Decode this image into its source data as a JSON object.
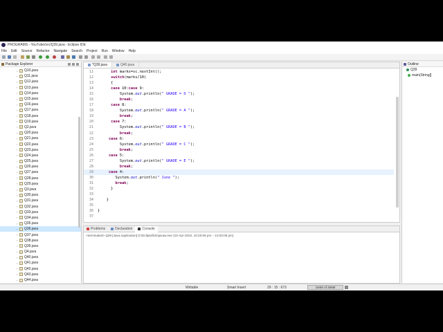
{
  "window": {
    "title": "PROGRAMS - YouTube/src/Q39.java - Eclipse IDE"
  },
  "menu": [
    "File",
    "Edit",
    "Source",
    "Refactor",
    "Navigate",
    "Search",
    "Project",
    "Run",
    "Window",
    "Help"
  ],
  "package_explorer": {
    "title": "Package Explorer",
    "items": [
      "Q10.java",
      "Q11.java",
      "Q12.java",
      "Q13.java",
      "Q14.java",
      "Q15.java",
      "Q16.java",
      "Q17.java",
      "Q18.java",
      "Q19.java",
      "Q2.java",
      "Q20.java",
      "Q21.java",
      "Q22.java",
      "Q23.java",
      "Q24.java",
      "Q25.java",
      "Q26.java",
      "Q27.java",
      "Q28.java",
      "Q29.java",
      "Q3.java",
      "Q30.java",
      "Q31.java",
      "Q32.java",
      "Q33.java",
      "Q34.java",
      "Q35.java",
      "Q36.java",
      "Q37.java",
      "Q38.java",
      "Q39.java",
      "Q4.java",
      "Q40.java",
      "Q41.java",
      "Q42.java",
      "Q43.java",
      "Q44.java"
    ],
    "selected": "Q36.java"
  },
  "editor": {
    "tabs": [
      "*Q39.java",
      "Q40.java"
    ],
    "active_tab": "*Q39.java",
    "current_line": "29",
    "lines": [
      {
        "n": "11",
        "t": "      int marks=sc.nextInt();"
      },
      {
        "n": "12",
        "t": "      switch(marks/10)"
      },
      {
        "n": "13",
        "t": "      {"
      },
      {
        "n": "14",
        "t": "      case 10:case 9:"
      },
      {
        "n": "15",
        "t": "          System.out.println(\" GRADE = O \");"
      },
      {
        "n": "16",
        "t": "          break;"
      },
      {
        "n": "17",
        "t": "      case 8:"
      },
      {
        "n": "18",
        "t": "          System.out.println(\" GRADE = A \");"
      },
      {
        "n": "19",
        "t": "          break;"
      },
      {
        "n": "20",
        "t": "      case 7:"
      },
      {
        "n": "21",
        "t": "          System.out.println(\" GRADE = B \");"
      },
      {
        "n": "22",
        "t": "          break;"
      },
      {
        "n": "23",
        "t": "     case 6:"
      },
      {
        "n": "24",
        "t": "          System.out.println(\" GRADE = C \");"
      },
      {
        "n": "25",
        "t": "          break;"
      },
      {
        "n": "26",
        "t": "     case 5:"
      },
      {
        "n": "27",
        "t": "          System.out.println(\" GRADE = E \");"
      },
      {
        "n": "28",
        "t": "          break;"
      },
      {
        "n": "29",
        "t": "     case 4:"
      },
      {
        "n": "30",
        "t": "        System.out.println(\" June \");"
      },
      {
        "n": "31",
        "t": "        break;"
      },
      {
        "n": "32",
        "t": "      }"
      },
      {
        "n": "33",
        "t": ""
      },
      {
        "n": "34",
        "t": "    }"
      },
      {
        "n": "35",
        "t": ""
      },
      {
        "n": "36",
        "t": "}"
      },
      {
        "n": "37",
        "t": ""
      }
    ]
  },
  "outline": {
    "title": "Outline",
    "class": "Q39",
    "method": "main(String[]"
  },
  "console": {
    "tabs": [
      "Problems",
      "Declaration",
      "Console"
    ],
    "active_tab": "Console",
    "terminated": "<terminated> Q39 [Java Application] D:\\Eclipse\\bin\\javaw.exe  (10-Apr-2022, 10:20:06 pm – 10:20:08 pm)"
  },
  "status": {
    "writable": "Writable",
    "insert": "Smart Insert",
    "position": "29 : 15 : 673",
    "heap": "194M of 256M"
  }
}
